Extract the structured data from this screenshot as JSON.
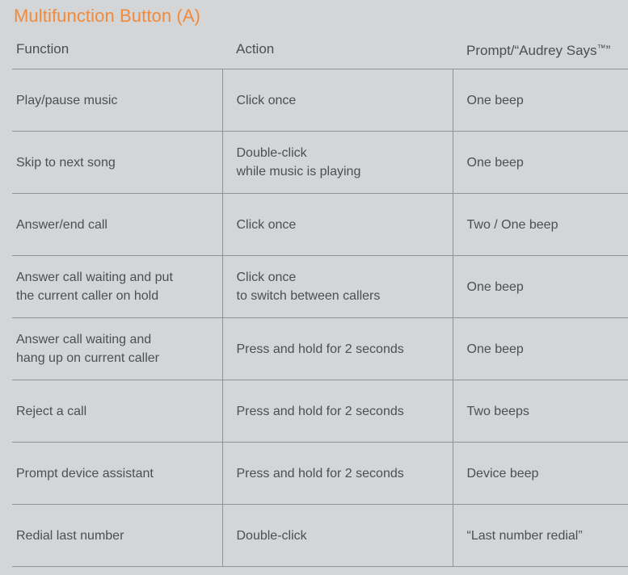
{
  "title": "Multifunction Button (A)",
  "colors": {
    "background": "#d3d5d6",
    "title_accent": "#f08a3c",
    "text": "#4a5055",
    "rule": "#8f9396"
  },
  "table": {
    "headers": {
      "function": "Function",
      "action": "Action",
      "prompt": "Prompt/“Audrey Says",
      "prompt_tm": "™",
      "prompt_tail": "”"
    },
    "rows": [
      {
        "function": [
          "Play/pause music"
        ],
        "action": [
          "Click once"
        ],
        "prompt": [
          "One beep"
        ]
      },
      {
        "function": [
          "Skip to next song"
        ],
        "action": [
          "Double-click",
          "while music is playing"
        ],
        "prompt": [
          "One beep"
        ]
      },
      {
        "function": [
          "Answer/end call"
        ],
        "action": [
          "Click once"
        ],
        "prompt": [
          "Two / One beep"
        ]
      },
      {
        "function": [
          "Answer call waiting and put",
          "the current caller on hold"
        ],
        "action": [
          "Click once",
          "to switch between callers"
        ],
        "prompt": [
          "One beep"
        ]
      },
      {
        "function": [
          "Answer call waiting and",
          "hang up on current caller"
        ],
        "action": [
          "Press and hold for 2 seconds"
        ],
        "prompt": [
          "One beep"
        ]
      },
      {
        "function": [
          "Reject a call"
        ],
        "action": [
          "Press and hold for 2 seconds"
        ],
        "prompt": [
          "Two beeps"
        ]
      },
      {
        "function": [
          "Prompt device assistant"
        ],
        "action": [
          "Press and hold for 2 seconds"
        ],
        "prompt": [
          "Device beep"
        ]
      },
      {
        "function": [
          "Redial last number"
        ],
        "action": [
          "Double-click"
        ],
        "prompt": [
          "“Last number redial”"
        ]
      }
    ]
  }
}
